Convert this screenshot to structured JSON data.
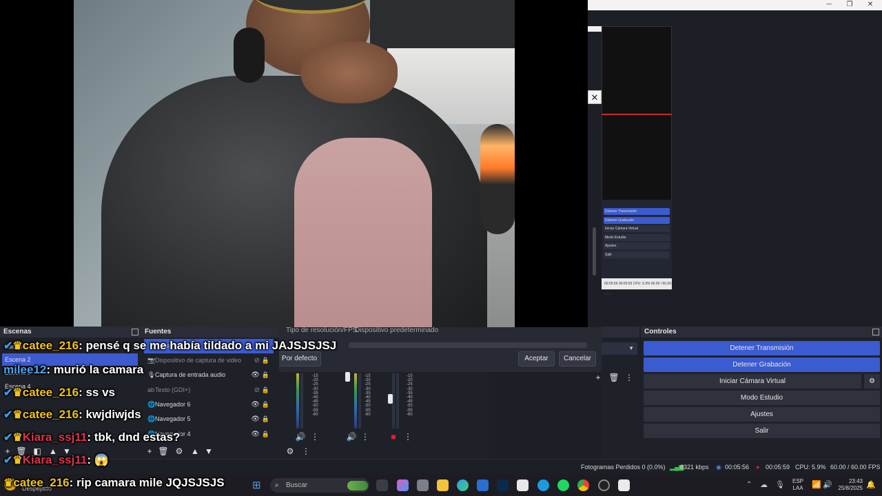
{
  "window": {
    "minimize": "─",
    "maximize": "❐",
    "close": "✕"
  },
  "dialog": {
    "close_label": "✕",
    "row_label": "Tipo de resolución/FPS",
    "row_value": "Dispositivo predeterminado",
    "default_button": "Por defecto",
    "ok_button": "Aceptar",
    "cancel_button": "Cancelar"
  },
  "mini_preview": {
    "buttons": [
      "Detener Transmisión",
      "Detener Grabación",
      "Iniciar Cámara Virtual",
      "Modo Estudio",
      "Ajustes",
      "Salir"
    ],
    "status": "00:05:56   00:05:59   CPU: 5.9%   60.00 / 60.00 FPS"
  },
  "scenes": {
    "title": "Escenas",
    "items": [
      "Escena",
      "Escena 2",
      "Escena 3",
      "Escena 4"
    ]
  },
  "sources": {
    "title": "Fuentes",
    "items": [
      {
        "label": "Navegador",
        "icon": "🌐"
      },
      {
        "label": "Dispositivo de captura de video",
        "icon": "📷"
      },
      {
        "label": "Captura de entrada audio",
        "icon": "🎙"
      },
      {
        "label": "Texto (GDI+)",
        "icon": "ab"
      },
      {
        "label": "Navegador 6",
        "icon": "🌐"
      },
      {
        "label": "Navegador 5",
        "icon": "🌐"
      },
      {
        "label": "Navegador 4",
        "icon": "🌐"
      }
    ]
  },
  "mixer": {
    "scale": [
      "-15",
      "-20",
      "-25",
      "-30",
      "-35",
      "-40",
      "-45",
      "-50",
      "-55",
      "-60"
    ]
  },
  "controls": {
    "title": "Controles",
    "buttons": [
      "Detener Transmisión",
      "Detener Grabación",
      "Iniciar Cámara Virtual",
      "Modo Estudio",
      "Ajustes",
      "Salir"
    ],
    "accent": "#3b5bd0"
  },
  "status": {
    "dropped": "Fotogramas Perdidos 0 (0.0%)",
    "bitrate": "8321 kbps",
    "stream_time": "00:05:56",
    "rec_time": "00:05:59",
    "cpu": "CPU: 5.9%",
    "fps": "60.00 / 60.00 FPS"
  },
  "taskbar": {
    "weather": "Despejado",
    "search_placeholder": "Buscar",
    "lang_top": "ESP",
    "lang_bottom": "LAA",
    "time": "23:43",
    "date": "25/8/2025"
  },
  "chat": [
    {
      "user": "catee_216",
      "color": "yellow",
      "text": "pensé q se me había tildado a mi JAJSJSJSJ"
    },
    {
      "user": "milee12",
      "color": "blue",
      "text": "murió la camara"
    },
    {
      "user": "catee_216",
      "color": "yellow",
      "text": "ss vs"
    },
    {
      "user": "catee_216",
      "color": "yellow",
      "text": "kwjdiwjds"
    },
    {
      "user": "Kiara_ssj11",
      "color": "red",
      "text": "tbk, dnd estas?"
    },
    {
      "user": "Kiara_ssj11",
      "color": "red",
      "text": "😱"
    },
    {
      "user": "catee_216",
      "color": "yellow",
      "text": "rip camara mile JQJSJSJS"
    }
  ]
}
